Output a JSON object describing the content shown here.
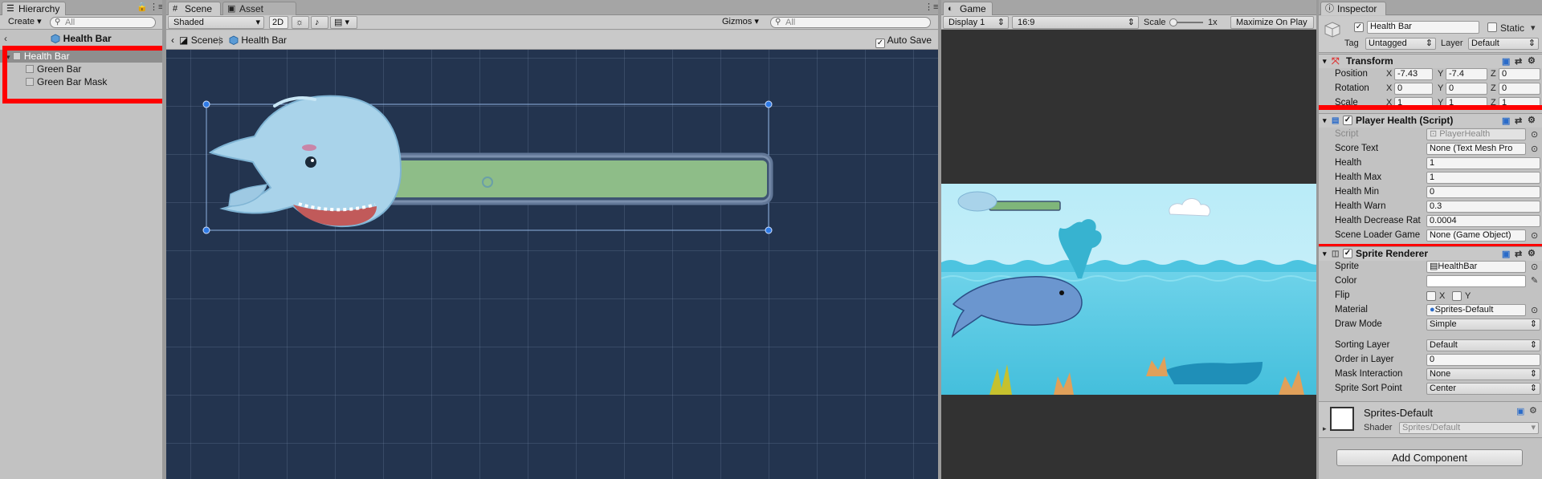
{
  "hierarchy": {
    "tab": "Hierarchy",
    "create_label": "Create",
    "search_placeholder": "All",
    "breadcrumb": "Health Bar",
    "items": [
      {
        "label": "Health Bar"
      },
      {
        "label": "Green Bar"
      },
      {
        "label": "Green Bar Mask"
      }
    ]
  },
  "scene": {
    "tabs": [
      "Scene",
      "Asset Store"
    ],
    "shading": "Shaded",
    "mode_2d": "2D",
    "gizmos": "Gizmos",
    "search_placeholder": "All",
    "breadcrumb_root": "Scenes",
    "breadcrumb_object": "Health Bar",
    "auto_save": "Auto Save"
  },
  "game": {
    "tab": "Game",
    "display": "Display 1",
    "aspect": "16:9",
    "scale_label": "Scale",
    "scale_value": "1x",
    "maximize": "Maximize On Play"
  },
  "inspector": {
    "tab": "Inspector",
    "object_name": "Health Bar",
    "static_label": "Static",
    "tag_label": "Tag",
    "tag_value": "Untagged",
    "layer_label": "Layer",
    "layer_value": "Default",
    "transform": {
      "title": "Transform",
      "rows": [
        {
          "label": "Position",
          "x": "-7.43",
          "y": "-7.4",
          "z": "0"
        },
        {
          "label": "Rotation",
          "x": "0",
          "y": "0",
          "z": "0"
        },
        {
          "label": "Scale",
          "x": "1",
          "y": "1",
          "z": "1"
        }
      ]
    },
    "player_health": {
      "title": "Player Health (Script)",
      "rows": [
        {
          "label": "Script",
          "value": "PlayerHealth"
        },
        {
          "label": "Score Text",
          "value": "None (Text Mesh Pro"
        },
        {
          "label": "Health",
          "value": "1"
        },
        {
          "label": "Health Max",
          "value": "1"
        },
        {
          "label": "Health Min",
          "value": "0"
        },
        {
          "label": "Health Warn",
          "value": "0.3"
        },
        {
          "label": "Health Decrease Rat",
          "value": "0.0004"
        },
        {
          "label": "Scene Loader Game",
          "value": "None (Game Object)"
        }
      ]
    },
    "sprite_renderer": {
      "title": "Sprite Renderer",
      "sprite_label": "Sprite",
      "sprite_value": "HealthBar",
      "color_label": "Color",
      "flip_label": "Flip",
      "flip_x": "X",
      "flip_y": "Y",
      "material_label": "Material",
      "material_value": "Sprites-Default",
      "draw_mode_label": "Draw Mode",
      "draw_mode_value": "Simple",
      "sorting_layer_label": "Sorting Layer",
      "sorting_layer_value": "Default",
      "order_label": "Order in Layer",
      "order_value": "0",
      "mask_label": "Mask Interaction",
      "mask_value": "None",
      "sort_point_label": "Sprite Sort Point",
      "sort_point_value": "Center"
    },
    "material": {
      "name": "Sprites-Default",
      "shader_label": "Shader",
      "shader_value": "Sprites/Default"
    },
    "add_component": "Add Component"
  }
}
